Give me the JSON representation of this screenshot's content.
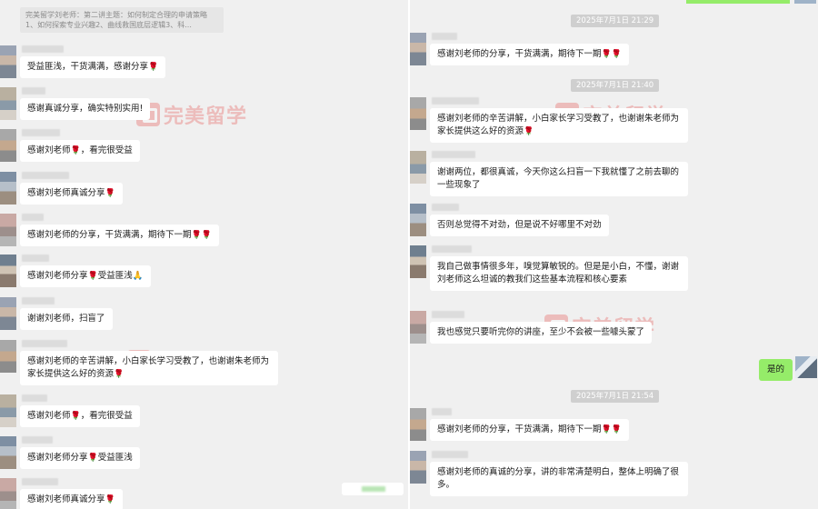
{
  "brand": {
    "watermark_text": "完美留学",
    "accent": "#e53935",
    "self_bubble_color": "#95ec69"
  },
  "left": {
    "quote": "完美留学刘老师：第二讲主题：如何制定合理的申请策略1、如何探索专业兴趣2、曲线救国底层逻辑3、科...",
    "messages": [
      {
        "text": "受益匪浅，干货满满，感谢分享",
        "emoji": "🌹"
      },
      {
        "text": "感谢真诚分享，确实特别实用!",
        "emoji": ""
      },
      {
        "text": "感谢刘老师",
        "emoji": "🌹",
        "text2": "，看完很受益"
      },
      {
        "text": "感谢刘老师真诚分享",
        "emoji": "🌹"
      },
      {
        "text": "感谢刘老师的分享，干货满满，期待下一期",
        "emoji": "🌹🌹"
      },
      {
        "text": "感谢刘老师分享",
        "emoji": "🌹",
        "text2": "受益匪浅",
        "emoji2": "🙏"
      },
      {
        "text": "谢谢刘老师，扫盲了",
        "emoji": ""
      },
      {
        "text": "感谢刘老师的辛苦讲解，小白家长学习受教了，也谢谢朱老师为家长提供这么好的资源",
        "emoji": "🌹"
      },
      {
        "text": "感谢刘老师",
        "emoji": "🌹",
        "text2": "，看完很受益"
      },
      {
        "text": "感谢刘老师分享",
        "emoji": "🌹",
        "text2": "受益匪浅"
      },
      {
        "text": "感谢刘老师真诚分享",
        "emoji": "🌹"
      }
    ]
  },
  "right": {
    "times": [
      "2025年7月1日 21:29",
      "2025年7月1日 21:40",
      "2025年7月1日 21:54"
    ],
    "messages": [
      {
        "text": "感谢刘老师的分享，干货满满，期待下一期",
        "emoji": "🌹🌹"
      },
      {
        "text": "感谢刘老师的辛苦讲解，小白家长学习受教了，也谢谢朱老师为家长提供这么好的资源",
        "emoji": "🌹"
      },
      {
        "text": "谢谢两位，都很真诚，今天你这么扫盲一下我就懂了之前去聊的一些现象了",
        "emoji": ""
      },
      {
        "text": "否则总觉得不对劲，但是说不好哪里不对劲",
        "emoji": ""
      },
      {
        "text": "我自己做事情很多年，嗅觉算敏锐的。但是是小白，不懂，谢谢刘老师这么坦诚的教我们这些基本流程和核心要素",
        "emoji": ""
      },
      {
        "text": "我也感觉只要听完你的讲座，至少不会被一些噱头蒙了",
        "emoji": ""
      },
      {
        "text": "感谢刘老师的分享，干货满满，期待下一期",
        "emoji": "🌹🌹"
      },
      {
        "text": "感谢刘老师的真诚的分享，讲的非常清楚明白，整体上明确了很多。",
        "emoji": ""
      }
    ],
    "self_reply": "是的"
  }
}
